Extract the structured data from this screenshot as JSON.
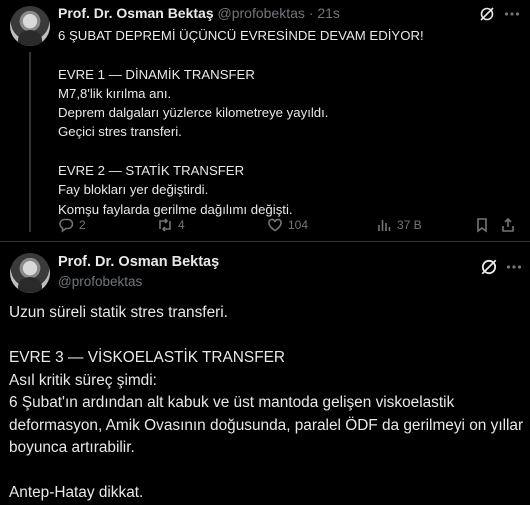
{
  "tweet1": {
    "author_name": "Prof. Dr. Osman Bektaş",
    "handle": "@profobektas",
    "separator": "·",
    "time": "21s",
    "lines": [
      "6 ŞUBAT DEPREMİ ÜÇÜNCÜ EVRESİNDE DEVAM EDİYOR!",
      "",
      "EVRE 1 — DİNAMİK TRANSFER",
      "M7,8'lik kırılma anı.",
      "Deprem dalgaları yüzlerce kilometreye yayıldı.",
      "Geçici stres transferi.",
      "",
      "EVRE 2 — STATİK TRANSFER",
      "Fay blokları yer değiştirdi.",
      "Komşu faylarda gerilme dağılımı değişti."
    ],
    "actions": {
      "reply_count": "2",
      "retweet_count": "4",
      "like_count": "104",
      "views_count": "37 B"
    },
    "icons": {
      "grok": "grok-icon",
      "more": "more-icon",
      "reply": "reply-icon",
      "retweet": "retweet-icon",
      "like": "heart-icon",
      "views": "views-icon",
      "bookmark": "bookmark-icon",
      "share": "share-icon"
    }
  },
  "tweet2": {
    "author_name": "Prof. Dr. Osman Bektaş",
    "handle": "@profobektas",
    "lines": [
      "Uzun süreli statik stres transferi.",
      "",
      "EVRE 3 — VİSKOELASTİK TRANSFER",
      "Asıl kritik süreç şimdi:",
      "6 Şubat'ın ardından alt kabuk ve üst mantoda gelişen viskoelastik",
      "deformasyon, Amik Ovasının doğusunda, paralel ÖDF da gerilmeyi on yıllar",
      "boyunca artırabilir.",
      "",
      "Antep-Hatay dikkat."
    ]
  },
  "colors": {
    "background": "#000000",
    "text": "#e7e9ea",
    "secondary": "#71767b",
    "divider": "#2f3336"
  }
}
